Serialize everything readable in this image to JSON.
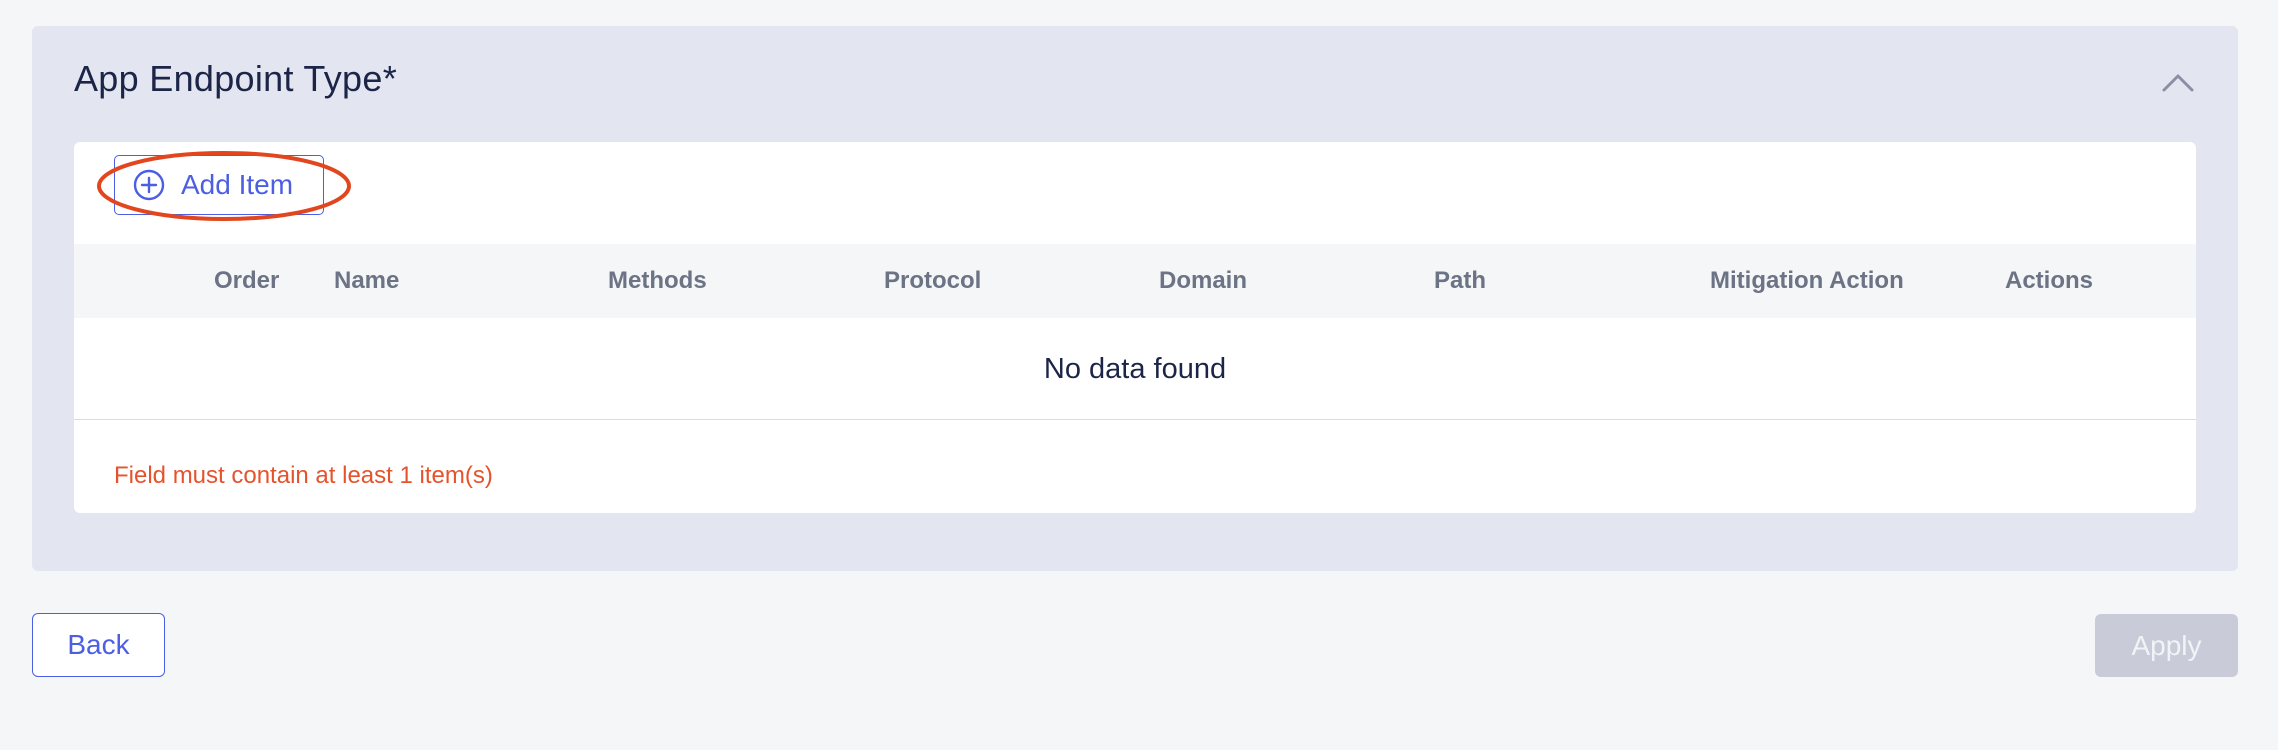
{
  "section": {
    "title": "App Endpoint Type",
    "required_marker": "*",
    "collapse_icon": "chevron-up-icon"
  },
  "toolbar": {
    "add_item_label": "Add Item",
    "add_item_icon": "plus-circle-icon"
  },
  "table": {
    "columns": [
      "Order",
      "Name",
      "Methods",
      "Protocol",
      "Domain",
      "Path",
      "Mitigation Action",
      "Actions"
    ],
    "empty_message": "No data found"
  },
  "validation": {
    "error": "Field must contain at least 1 item(s)"
  },
  "footer": {
    "back_label": "Back",
    "apply_label": "Apply"
  },
  "colors": {
    "accent": "#4b5ee4",
    "error": "#e5532d",
    "section_bg": "#e3e5f0",
    "disabled_button": "#c9ccd8"
  }
}
